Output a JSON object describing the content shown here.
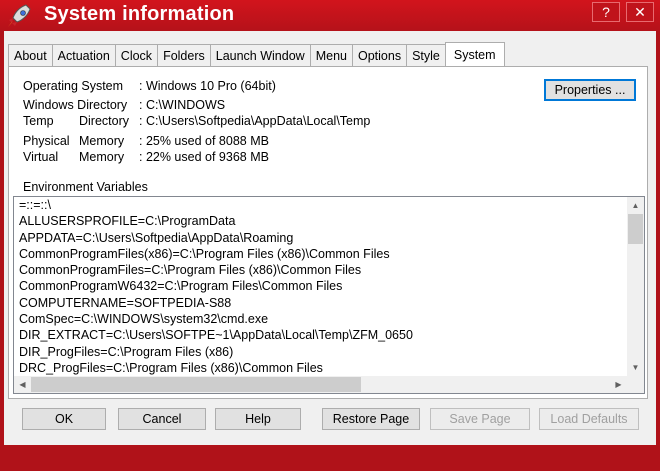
{
  "window": {
    "title": "System information",
    "controls": [
      "?",
      "✕"
    ]
  },
  "tabs": [
    "About",
    "Actuation",
    "Clock",
    "Folders",
    "Launch Window",
    "Menu",
    "Options",
    "Style",
    "System"
  ],
  "active_tab": "System",
  "system": {
    "os_label": "Operating System",
    "os_value": ": Windows 10 Pro (64bit)",
    "windir_label": "Windows Directory",
    "windir_value": ": C:\\WINDOWS",
    "temp_label1": "Temp",
    "temp_label2": "Directory",
    "temp_value": ": C:\\Users\\Softpedia\\AppData\\Local\\Temp",
    "phys_label1": "Physical",
    "phys_label2": "Memory",
    "phys_value": ": 25% used of 8088 MB",
    "virt_label1": "Virtual",
    "virt_label2": "Memory",
    "virt_value": ": 22% used of 9368 MB",
    "properties_button": "Properties ..."
  },
  "env": {
    "label": "Environment Variables",
    "lines": [
      "=::=::\\",
      "ALLUSERSPROFILE=C:\\ProgramData",
      "APPDATA=C:\\Users\\Softpedia\\AppData\\Roaming",
      "CommonProgramFiles(x86)=C:\\Program Files (x86)\\Common Files",
      "CommonProgramFiles=C:\\Program Files (x86)\\Common Files",
      "CommonProgramW6432=C:\\Program Files\\Common Files",
      "COMPUTERNAME=SOFTPEDIA-S88",
      "ComSpec=C:\\WINDOWS\\system32\\cmd.exe",
      "DIR_EXTRACT=C:\\Users\\SOFTPE~1\\AppData\\Local\\Temp\\ZFM_0650",
      "DIR_ProgFiles=C:\\Program Files (x86)",
      "DRC_ProgFiles=C:\\Program Files (x86)\\Common Files"
    ]
  },
  "buttons": {
    "ok": "OK",
    "cancel": "Cancel",
    "help": "Help",
    "restore": "Restore Page",
    "save": "Save Page",
    "load_defaults": "Load Defaults"
  }
}
